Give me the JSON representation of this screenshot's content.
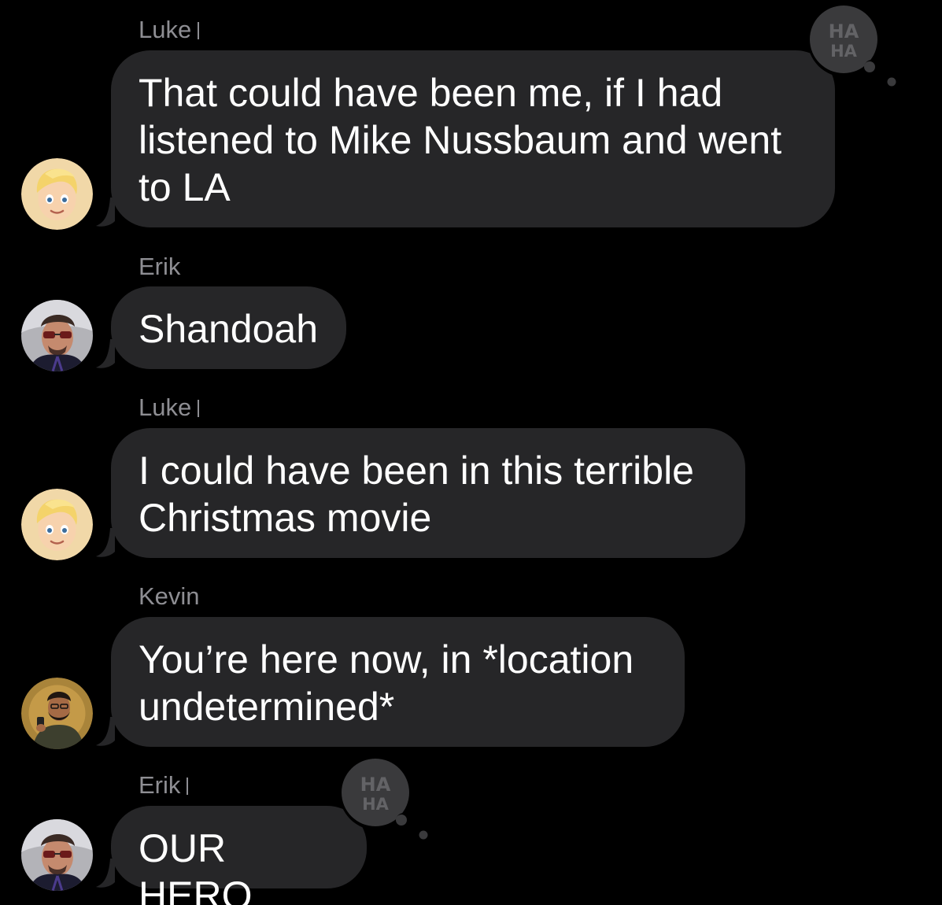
{
  "conversation": {
    "messages": [
      {
        "sender": "Luke",
        "text": "That could have been me, if I had\nlistened to Mike Nussbaum and went\nto LA",
        "avatar": "memoji-blond-boy",
        "reaction": "haha"
      },
      {
        "sender": "Erik",
        "text": "Shandoah",
        "avatar": "photo-man-sunglasses",
        "reaction": ""
      },
      {
        "sender": "Luke",
        "text": "I could have been in this terrible\nChristmas movie",
        "avatar": "memoji-blond-boy",
        "reaction": ""
      },
      {
        "sender": "Kevin",
        "text": "You’re here now, in *location\nundetermined*",
        "avatar": "cartoon-bearded-man-phone",
        "reaction": ""
      },
      {
        "sender": "Erik",
        "text": "OUR HERO",
        "avatar": "photo-man-sunglasses",
        "reaction": "haha"
      }
    ],
    "tapback_label": "HA\nHA"
  },
  "colors": {
    "background": "#000000",
    "bubble": "#262628",
    "sender_name": "#8e8e93",
    "message_text": "#ffffff",
    "tapback_badge": "#3a3a3c"
  },
  "icons": {
    "tapback": "haha-tapback-icon",
    "bubble_tail": "bubble-tail-icon"
  }
}
